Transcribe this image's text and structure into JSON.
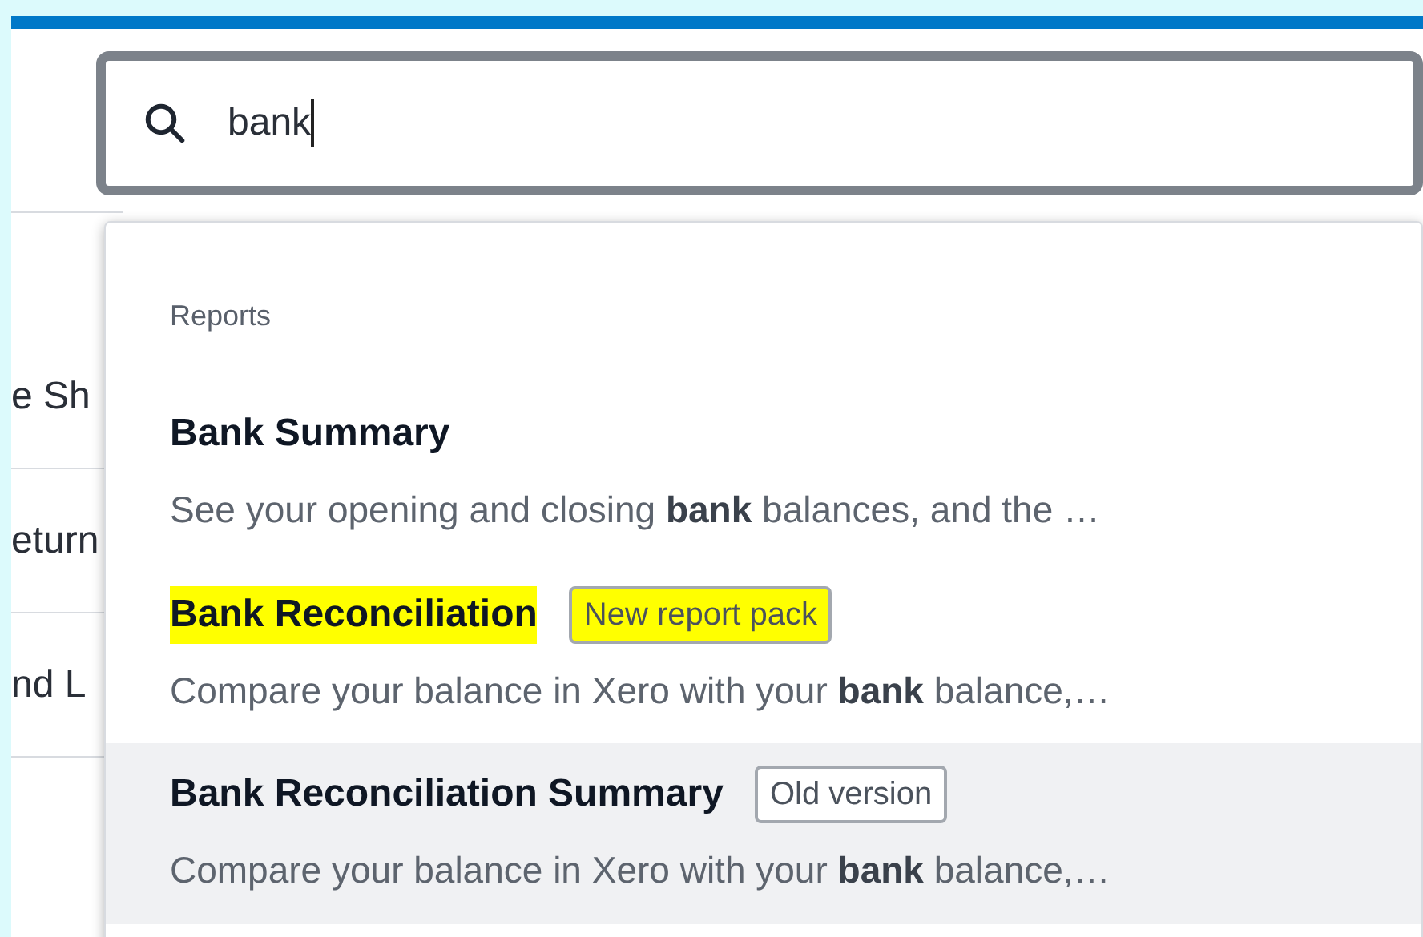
{
  "search": {
    "value": "bank"
  },
  "background_rows": [
    {
      "label": "e Sh"
    },
    {
      "label": "eturn"
    },
    {
      "label": "nd L"
    }
  ],
  "dropdown": {
    "heading": "Reports",
    "items": [
      {
        "title": "Bank Summary",
        "description": "See your opening and closing **bank** balances, and the …",
        "highlighted": false,
        "selected": false
      },
      {
        "title": "Bank Reconciliation",
        "badge": "New report pack",
        "description": "Compare your balance in Xero with your **bank** balance,…",
        "highlighted": true,
        "selected": false
      },
      {
        "title": "Bank Reconciliation Summary",
        "badge": "Old version",
        "description": "Compare your balance in Xero with your **bank** balance,…",
        "highlighted": false,
        "selected": true
      }
    ]
  }
}
